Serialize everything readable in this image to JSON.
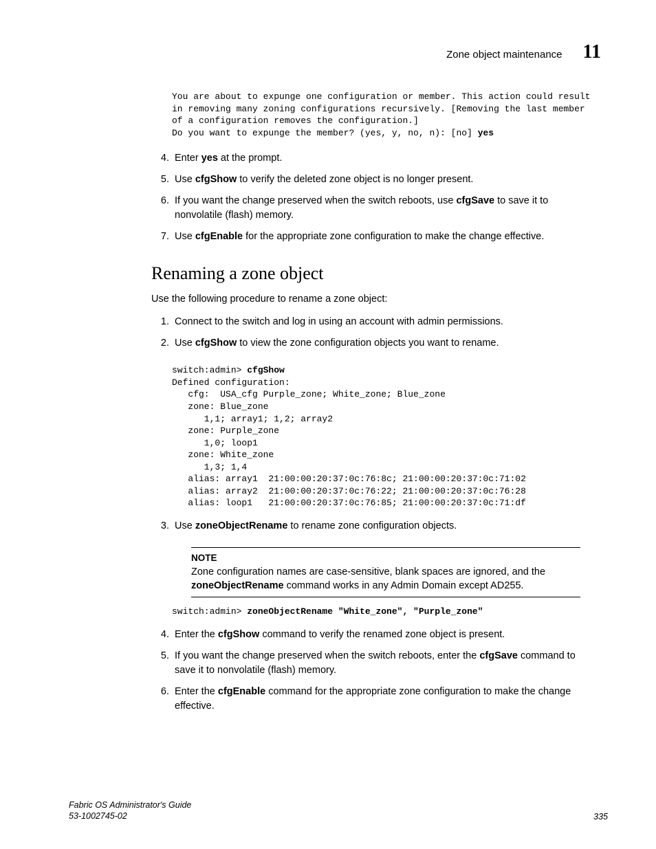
{
  "header": {
    "title": "Zone object maintenance",
    "chapter": "11"
  },
  "code1": "You are about to expunge one configuration or member. This action could result\nin removing many zoning configurations recursively. [Removing the last member\nof a configuration removes the configuration.]\nDo you want to expunge the member? (yes, y, no, n): [no] ",
  "code1_bold": "yes",
  "list1": {
    "start": 4,
    "i4_a": "Enter ",
    "i4_b": "yes",
    "i4_c": " at the prompt.",
    "i5_a": "Use ",
    "i5_b": "cfgShow",
    "i5_c": " to verify the deleted zone object is no longer present.",
    "i6_a": "If you want the change preserved when the switch reboots, use ",
    "i6_b": "cfgSave",
    "i6_c": " to save it to nonvolatile (flash) memory.",
    "i7_a": "Use ",
    "i7_b": "cfgEnable",
    "i7_c": " for the appropriate zone configuration to make the change effective."
  },
  "section_heading": "Renaming a zone object",
  "intro": "Use the following procedure to rename a zone object:",
  "list2a": {
    "start": 1,
    "i1": "Connect to the switch and log in using an account with admin permissions.",
    "i2_a": "Use ",
    "i2_b": "cfgShow",
    "i2_c": " to view the zone configuration objects you want to rename."
  },
  "code2_prompt": "switch:admin> ",
  "code2_cmd": "cfgShow",
  "code2_body": "Defined configuration:\n   cfg:  USA_cfg Purple_zone; White_zone; Blue_zone\n   zone: Blue_zone\n      1,1; array1; 1,2; array2\n   zone: Purple_zone\n      1,0; loop1\n   zone: White_zone\n      1,3; 1,4\n   alias: array1  21:00:00:20:37:0c:76:8c; 21:00:00:20:37:0c:71:02\n   alias: array2  21:00:00:20:37:0c:76:22; 21:00:00:20:37:0c:76:28\n   alias: loop1   21:00:00:20:37:0c:76:85; 21:00:00:20:37:0c:71:df",
  "list2b": {
    "start": 3,
    "i3_a": "Use ",
    "i3_b": "zoneObjectRename",
    "i3_c": " to rename zone configuration objects."
  },
  "note": {
    "label": "NOTE",
    "t1": "Zone configuration names are case-sensitive, blank spaces are ignored, and the ",
    "t2": "zoneObjectRename",
    "t3": " command works in any Admin Domain except AD255."
  },
  "code3_prompt": "switch:admin> ",
  "code3_cmd": "zoneObjectRename \"White_zone\", \"Purple_zone\"",
  "list2c": {
    "start": 4,
    "i4_a": "Enter the ",
    "i4_b": "cfgShow",
    "i4_c": " command to verify the renamed zone object is present.",
    "i5_a": "If you want the change preserved when the switch reboots, enter the ",
    "i5_b": "cfgSave",
    "i5_c": " command to save it to nonvolatile (flash) memory.",
    "i6_a": "Enter the ",
    "i6_b": "cfgEnable",
    "i6_c": " command for the appropriate zone configuration to make the change effective."
  },
  "footer": {
    "book": "Fabric OS Administrator's Guide",
    "docnum": "53-1002745-02",
    "page": "335"
  }
}
